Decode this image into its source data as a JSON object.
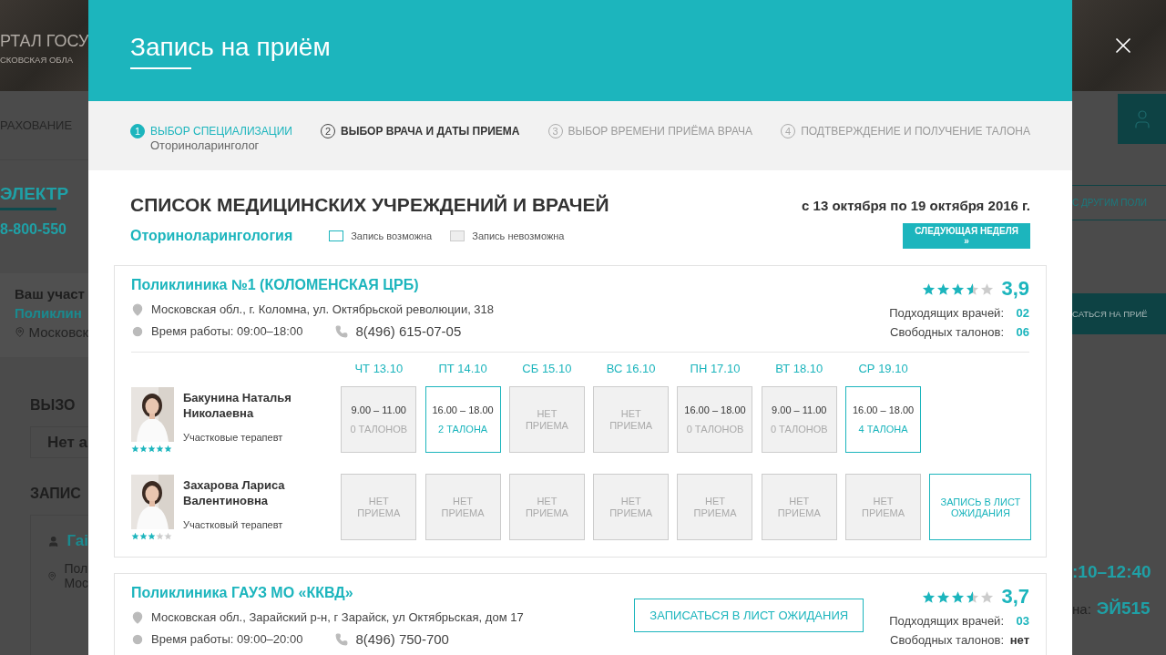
{
  "background": {
    "header_title": "РТАЛ ГОСУ",
    "header_subtitle": "СКОВСКАЯ ОБЛА",
    "nav_item": "РАХОВАНИЕ",
    "section_title": "ЭЛЕКТР",
    "phone": "8-800-550",
    "district": {
      "label": "Ваш участ",
      "clinic": "Поликлин",
      "address": "Московск"
    },
    "call_title": "ВЫЗО",
    "call_text": "Нет а",
    "appointments_title": "ЗАПИС",
    "appointment": {
      "doctor": "Гаі",
      "line_1": "Пол",
      "line_2": "Мос"
    },
    "compare_button": "С ДРУГИМ ПОЛИ",
    "book_button": "САТЬСЯ НА ПРИЁ",
    "time": ":10–12:40",
    "ticket_label": "на:",
    "ticket_number": "ЭЙ515"
  },
  "modal": {
    "title": "Запись на приём",
    "steps": [
      {
        "number": "1",
        "label": "ВЫБОР СПЕЦИАЛИЗАЦИИ",
        "sublabel": "Оториноларинголог",
        "completed": true,
        "selected": false
      },
      {
        "number": "2",
        "label": "ВЫБОР ВРАЧА И ДАТЫ ПРИЕМА",
        "completed": false,
        "selected": true
      },
      {
        "number": "3",
        "label": "ВЫБОР ВРЕМЕНИ ПРИЁМА ВРАЧА",
        "completed": false,
        "selected": false
      },
      {
        "number": "4",
        "label": "ПОДТВЕРЖДЕНИЕ И ПОЛУЧЕНИЕ ТАЛОНА",
        "completed": false,
        "selected": false
      }
    ],
    "list_title": "СПИСОК МЕДИЦИНСКИХ УЧРЕЖДЕНИЙ И ВРАЧЕЙ",
    "date_range": "с 13 октября по 19 октября 2016 г.",
    "specialty": "Оториноларингология",
    "legend": [
      {
        "kind": "available",
        "label": "Запись возможна"
      },
      {
        "kind": "unavailable",
        "label": "Запись невозможна"
      }
    ],
    "next_week_button": "СЛЕДУЮЩАЯ НЕДЕЛЯ »",
    "clinics": [
      {
        "name": "Поликлиника №1 (КОЛОМЕНСКАЯ ЦРБ)",
        "stars": 3.5,
        "rating": "3,9",
        "address": "Московская обл., г. Коломна, ул. Октябрьской революции, 318",
        "hours": "Время работы: 09:00–18:00",
        "phone": "8(496) 615-07-05",
        "doctors_label": "Подходящих врачей:",
        "doctors_count": "02",
        "tickets_label": "Свободных талонов:",
        "tickets_count": "06",
        "days": [
          "ЧТ 13.10",
          "ПТ 14.10",
          "СБ 15.10",
          "ВС 16.10",
          "ПН 17.10",
          "ВТ 18.10",
          "СР 19.10"
        ],
        "doctors": [
          {
            "name": "Бакунина Наталья Николаевна",
            "role": "Участковые терапевт",
            "stars": 5,
            "slots": [
              {
                "kind": "full",
                "time": "9.00 – 11.00",
                "tickets": "0 ТАЛОНОВ"
              },
              {
                "kind": "open",
                "time": "16.00 – 18.00",
                "tickets": "2 ТАЛОНА"
              },
              {
                "kind": "closed",
                "text": "НЕТ ПРИЕМА"
              },
              {
                "kind": "closed",
                "text": "НЕТ ПРИЕМА"
              },
              {
                "kind": "full",
                "time": "16.00 – 18.00",
                "tickets": "0 ТАЛОНОВ"
              },
              {
                "kind": "full",
                "time": "9.00 – 11.00",
                "tickets": "0 ТАЛОНОВ"
              },
              {
                "kind": "open",
                "time": "16.00 – 18.00",
                "tickets": "4 ТАЛОНА"
              }
            ]
          },
          {
            "name": "Захарова Лариса Валентиновна",
            "role": "Участковый терапевт",
            "stars": 3,
            "slots": [
              {
                "kind": "closed",
                "text": "НЕТ ПРИЕМА"
              },
              {
                "kind": "closed",
                "text": "НЕТ ПРИЕМА"
              },
              {
                "kind": "closed",
                "text": "НЕТ ПРИЕМА"
              },
              {
                "kind": "closed",
                "text": "НЕТ ПРИЕМА"
              },
              {
                "kind": "closed",
                "text": "НЕТ ПРИЕМА"
              },
              {
                "kind": "closed",
                "text": "НЕТ ПРИЕМА"
              },
              {
                "kind": "closed",
                "text": "НЕТ ПРИЕМА"
              }
            ],
            "waitlist_button": "ЗАПИСЬ В ЛИСТ ОЖИДАНИЯ"
          }
        ]
      },
      {
        "name": "Поликлиника ГАУЗ МО «ККВД»",
        "stars": 3.5,
        "rating": "3,7",
        "address": "Московская обл., Зарайский р-н, г Зарайск, ул Октябрьская, дом 17",
        "hours": "Время работы: 09:00–20:00",
        "phone": "8(496) 750-700",
        "waitlist_button": "ЗАПИСАТЬСЯ В ЛИСТ ОЖИДАНИЯ",
        "doctors_label": "Подходящих врачей:",
        "doctors_count": "03",
        "tickets_label": "Свободных талонов:",
        "tickets_count": "нет"
      }
    ]
  }
}
